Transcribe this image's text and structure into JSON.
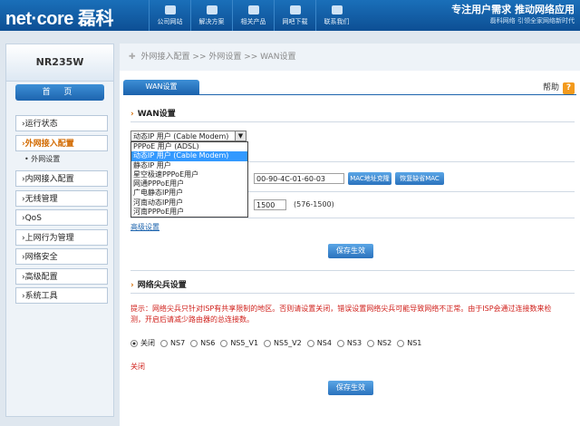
{
  "header": {
    "logo": "net·core 磊科",
    "nav": [
      "公司网站",
      "解决方案",
      "相关产品",
      "网吧下载",
      "联系我们"
    ],
    "slogan": "专注用户需求  推动网络应用",
    "slogan_sub": "磊科网络 引领全家网络新时代"
  },
  "sidebar": {
    "model": "NR235W",
    "home_label": "首 页",
    "items": [
      {
        "label": "›运行状态"
      },
      {
        "label": "›外网接入配置"
      },
      {
        "label": "›内网接入配置"
      },
      {
        "label": "›无线管理"
      },
      {
        "label": "›QoS"
      },
      {
        "label": "›上网行为管理"
      },
      {
        "label": "›网络安全"
      },
      {
        "label": "›高级配置"
      },
      {
        "label": "›系统工具"
      }
    ],
    "sub_item": "• 外网设置"
  },
  "main": {
    "breadcrumb": "外网接入配置  >>  外网设置  >>  WAN设置",
    "tab_label": "WAN设置",
    "help_label": "帮助",
    "help_icon": "?",
    "wan_section_title": "WAN设置",
    "select_value": "动态IP 用户 (Cable Modem)",
    "dropdown_options": [
      "PPPoE 用户 (ADSL)",
      "动态IP 用户 (Cable Modem)",
      "静态IP 用户",
      "星空极速PPPoE用户",
      "网通PPPoE用户",
      "广电静态IP用户",
      "河南动态IP用户",
      "河南PPPoE用户"
    ],
    "mac_value": "00-90-4C-01-60-03",
    "mac_clone_label": "MAC地址克隆",
    "mac_restore_label": "恢复缺省MAC",
    "mtu_value": "1500",
    "mtu_range": "(576-1500)",
    "advanced_link": "高级设置",
    "save_label": "保存生效",
    "anti_section_title": "网络尖兵设置",
    "tip": "提示：网络尖兵只针对ISP有共享限制的地区。否则请设置关闭，错误设置网络尖兵可能导致网络不正常。由于ISP会通过连接数来检测，开启后请减少路由器的总连接数。",
    "radio_options": [
      "关闭",
      "NS7",
      "NS6",
      "NS5_V1",
      "NS5_V2",
      "NS4",
      "NS3",
      "NS2",
      "NS1"
    ],
    "radio_selected": "关闭",
    "status_text": "关闭",
    "save_label_2": "保存生效"
  }
}
